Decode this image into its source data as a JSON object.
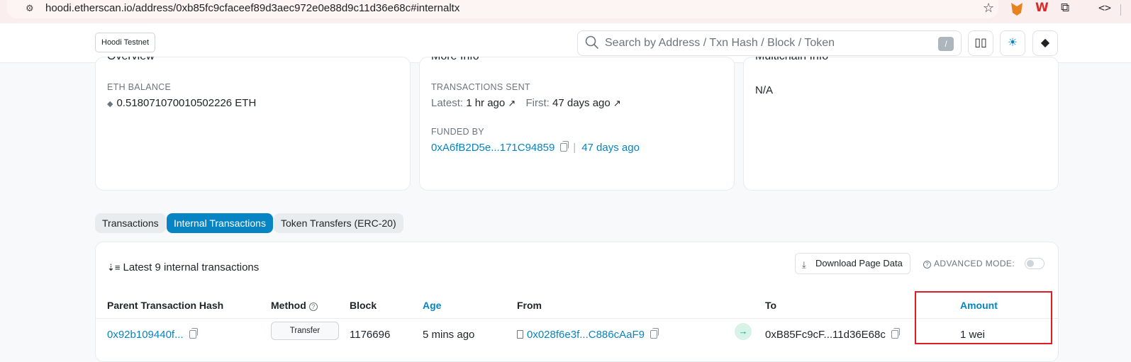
{
  "browser": {
    "url": "hoodi.etherscan.io/address/0xb85fc9cfaceef89d3aec972e0e88d9c11d36e68c#internaltx"
  },
  "header": {
    "network_badge": "Hoodi Testnet",
    "search_placeholder": "Search by Address / Txn Hash / Block / Token",
    "search_shortcut": "/"
  },
  "overview": {
    "title": "Overview",
    "eth_balance_label": "ETH BALANCE",
    "eth_balance_value": "0.518071070010502226 ETH"
  },
  "more_info": {
    "title": "More Info",
    "tx_sent_label": "TRANSACTIONS SENT",
    "latest_label": "Latest:",
    "latest_value": "1 hr ago",
    "first_label": "First:",
    "first_value": "47 days ago",
    "funded_by_label": "FUNDED BY",
    "funded_by_address": "0xA6fB2D5e...171C94859",
    "funded_by_age": "47 days ago"
  },
  "multichain": {
    "title": "Multichain Info",
    "value": "N/A"
  },
  "tabs": [
    {
      "label": "Transactions",
      "active": false
    },
    {
      "label": "Internal Transactions",
      "active": true
    },
    {
      "label": "Token Transfers (ERC-20)",
      "active": false
    }
  ],
  "table": {
    "count_text": "Latest 9 internal transactions",
    "download_label": "Download Page Data",
    "advanced_mode_label": "ADVANCED MODE:",
    "columns": {
      "parent_hash": "Parent Transaction Hash",
      "method": "Method",
      "block": "Block",
      "age": "Age",
      "from": "From",
      "to": "To",
      "amount": "Amount"
    },
    "rows": [
      {
        "parent_hash": "0x92b109440f...",
        "method": "Transfer",
        "block": "1176696",
        "age": "5 mins ago",
        "from": "0x028f6e3f...C886cAaF9",
        "to": "0xB85Fc9cF...11d36E68c",
        "amount": "1 wei"
      }
    ]
  },
  "colors": {
    "accent": "#0784c3",
    "highlight_box": "#e01b24",
    "arrow_bg": "#d7f2e7",
    "arrow_fg": "#00a186"
  }
}
